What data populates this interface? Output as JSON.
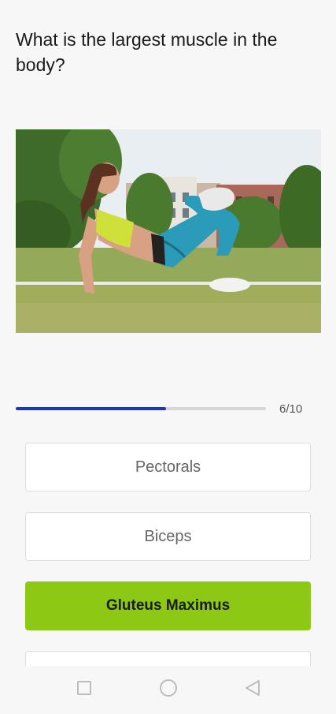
{
  "question": {
    "text": "What is the largest muscle in the body?"
  },
  "image": {
    "description_icon": "woman-exercising-photo"
  },
  "progress": {
    "current": 6,
    "total": 10,
    "label": "6/10",
    "fraction": 0.6,
    "color": "#1f3aa6"
  },
  "answers": [
    {
      "label": "Pectorals",
      "selected": false
    },
    {
      "label": "Biceps",
      "selected": false
    },
    {
      "label": "Gluteus Maximus",
      "selected": true
    }
  ],
  "colors": {
    "selected": "#8cc814",
    "background": "#f7f7f7"
  },
  "navbar": {
    "items": [
      "recents-icon",
      "home-icon",
      "back-icon"
    ]
  }
}
